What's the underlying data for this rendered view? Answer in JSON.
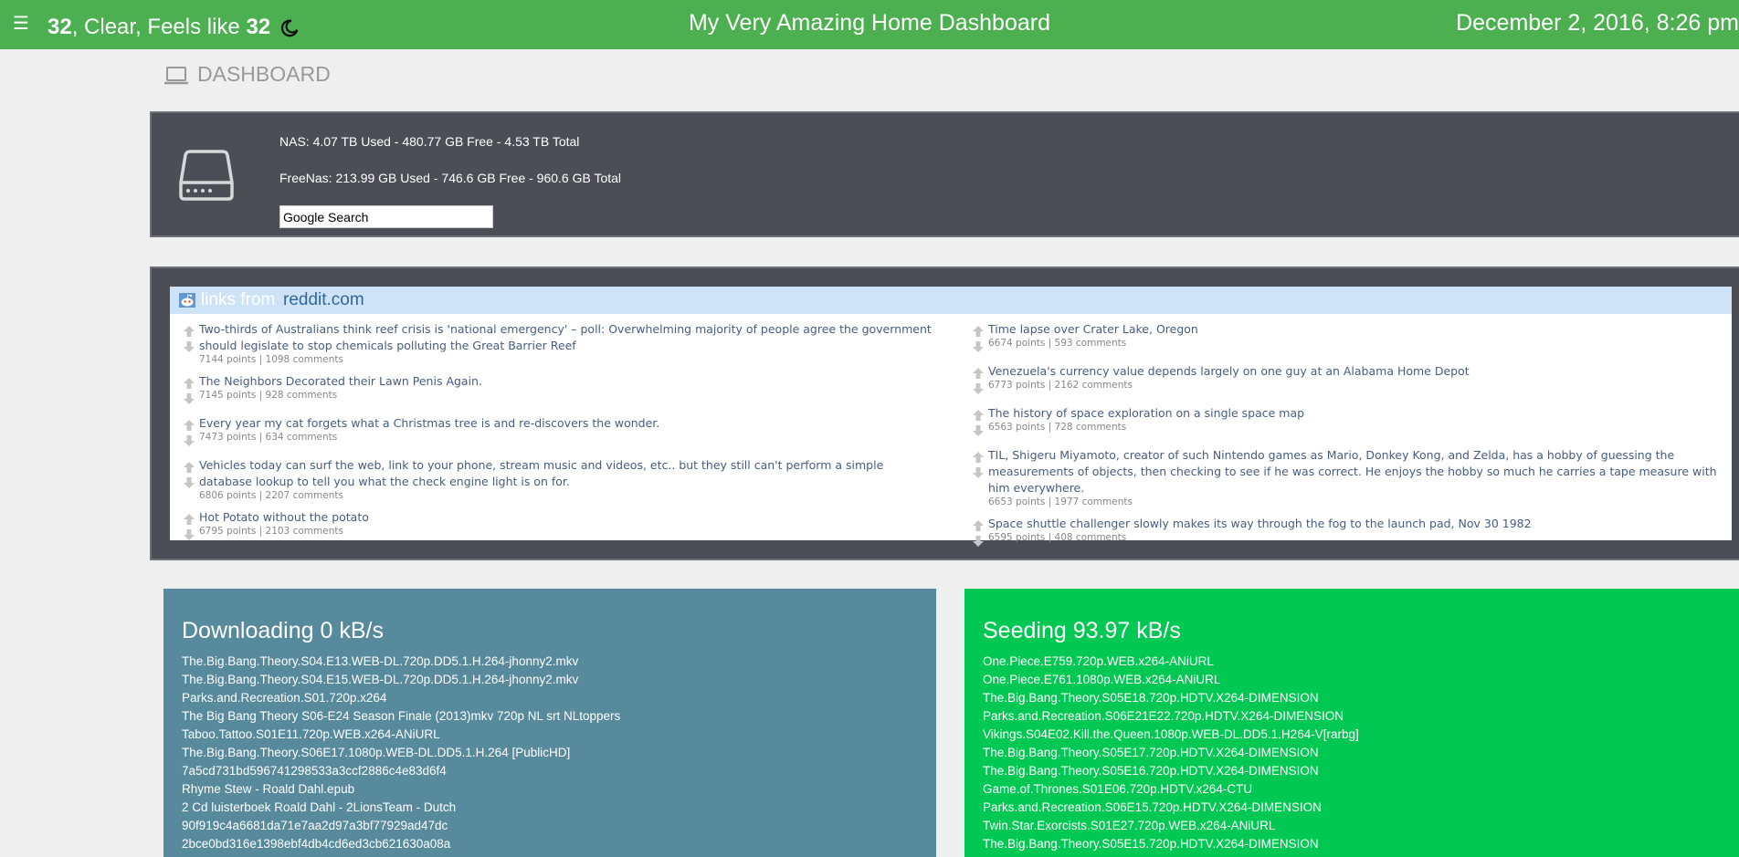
{
  "topbar": {
    "menu_icon": "hamburger-icon",
    "temperature": "32",
    "condition": ", Clear, Feels like ",
    "feels_like": "32",
    "weather_icon": "moon-icon",
    "title": "My Very Amazing Home Dashboard",
    "datetime": "December 2, 2016, 8:26 pm",
    "color": "#4caf50"
  },
  "dashboard": {
    "icon": "laptop-icon",
    "label": "DASHBOARD"
  },
  "storage": {
    "icon": "hard-drive-icon",
    "nas": "NAS: 4.07 TB Used - 480.77 GB Free - 4.53 TB Total",
    "freenas": "FreeNas: 213.99 GB Used - 746.6 GB Free - 960.6 GB Total",
    "search_placeholder": "Google Search"
  },
  "reddit": {
    "links_from": "links from",
    "domain": "reddit.com",
    "left": [
      {
        "title": "Two-thirds of Australians think reef crisis is 'national emergency' – poll: Overwhelming majority of people agree the government should legislate to stop chemicals polluting the Great Barrier Reef",
        "meta": "7144 points | 1098 comments"
      },
      {
        "title": "The Neighbors Decorated their Lawn Penis Again.",
        "meta": "7145 points | 928 comments"
      },
      {
        "title": "Every year my cat forgets what a Christmas tree is and re-discovers the wonder.",
        "meta": "7473 points | 634 comments"
      },
      {
        "title": "Vehicles today can surf the web, link to your phone, stream music and videos, etc.. but they still can't perform a simple database lookup to tell you what the check engine light is on for.",
        "meta": "6806 points | 2207 comments"
      },
      {
        "title": "Hot Potato without the potato",
        "meta": "6795 points | 2103 comments"
      }
    ],
    "right": [
      {
        "title": "Time lapse over Crater Lake, Oregon",
        "meta": "6674 points | 593 comments"
      },
      {
        "title": "Venezuela's currency value depends largely on one guy at an Alabama Home Depot",
        "meta": "6773 points | 2162 comments"
      },
      {
        "title": "The history of space exploration on a single space map",
        "meta": "6563 points | 728 comments"
      },
      {
        "title": "TIL, Shigeru Miyamoto, creator of such Nintendo games as Mario, Donkey Kong, and Zelda, has a hobby of guessing the measurements of objects, then checking to see if he was correct. He enjoys the hobby so much he carries a tape measure with him everywhere.",
        "meta": "6653 points | 1977 comments"
      },
      {
        "title": "Space shuttle challenger slowly makes its way through the fog to the launch pad, Nov 30 1982",
        "meta": "6595 points | 408 comments"
      }
    ]
  },
  "downloading": {
    "title": "Downloading 0 kB/s",
    "color": "#588a9d",
    "items": [
      "The.Big.Bang.Theory.S04.E13.WEB-DL.720p.DD5.1.H.264-jhonny2.mkv",
      "The.Big.Bang.Theory.S04.E15.WEB-DL.720p.DD5.1.H.264-jhonny2.mkv",
      "Parks.and.Recreation.S01.720p.x264",
      "The Big Bang Theory S06-E24 Season Finale (2013)mkv 720p NL srt NLtoppers",
      "Taboo.Tattoo.S01E11.720p.WEB.x264-ANiURL",
      "The.Big.Bang.Theory.S06E17.1080p.WEB-DL.DD5.1.H.264 [PublicHD]",
      "7a5cd731bd596741298533a3ccf2886c4e83d6f4",
      "Rhyme Stew - Roald Dahl.epub",
      "2 Cd luisterboek Roald Dahl - 2LionsTeam - Dutch",
      "90f919c4a6681da71e7aa2d97a3bf77929ad47dc",
      "2bce0bd316e1398ebf4db4cd6ed3cb621630a08a"
    ]
  },
  "seeding": {
    "title": "Seeding 93.97 kB/s",
    "color": "#00c853",
    "items": [
      "One.Piece.E759.720p.WEB.x264-ANiURL",
      "One.Piece.E761.1080p.WEB.x264-ANiURL",
      "The.Big.Bang.Theory.S05E18.720p.HDTV.X264-DIMENSION",
      "Parks.and.Recreation.S06E21E22.720p.HDTV.X264-DIMENSION",
      "Vikings.S04E02.Kill.the.Queen.1080p.WEB-DL.DD5.1.H264-V[rarbg]",
      "The.Big.Bang.Theory.S05E17.720p.HDTV.X264-DIMENSION",
      "The.Big.Bang.Theory.S05E16.720p.HDTV.X264-DIMENSION",
      "Game.of.Thrones.S01E06.720p.HDTV.x264-CTU",
      "Parks.and.Recreation.S06E15.720p.HDTV.X264-DIMENSION",
      "Twin.Star.Exorcists.S01E27.720p.WEB.x264-ANiURL",
      "The.Big.Bang.Theory.S05E15.720p.HDTV.X264-DIMENSION"
    ]
  }
}
